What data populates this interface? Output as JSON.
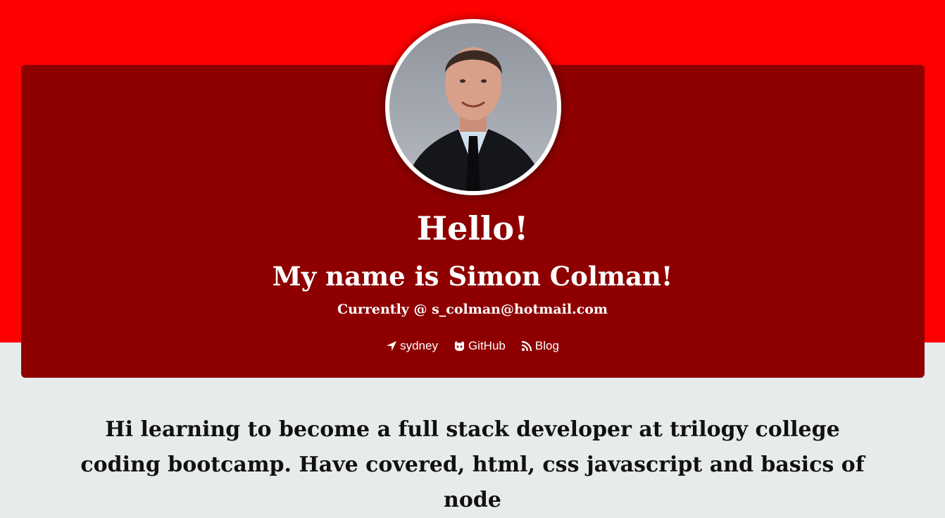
{
  "header": {
    "greeting": "Hello!",
    "name_line": "My name is Simon Colman!",
    "current_line": "Currently @ s_colman@hotmail.com",
    "avatar_alt": "Profile photo of Simon Colman"
  },
  "links": {
    "location": {
      "label": "sydney",
      "icon": "location-arrow-icon"
    },
    "github": {
      "label": "GitHub",
      "icon": "github-icon"
    },
    "blog": {
      "label": "Blog",
      "icon": "rss-icon"
    }
  },
  "bio": {
    "text": "Hi learning to become a full stack developer at trilogy college coding bootcamp. Have covered, html, css javascript and basics of node"
  },
  "colors": {
    "band": "#ff0000",
    "card": "#8e0000",
    "page_background": "#e8ebec",
    "text_light": "#ffffff",
    "text_dark": "#111111"
  }
}
